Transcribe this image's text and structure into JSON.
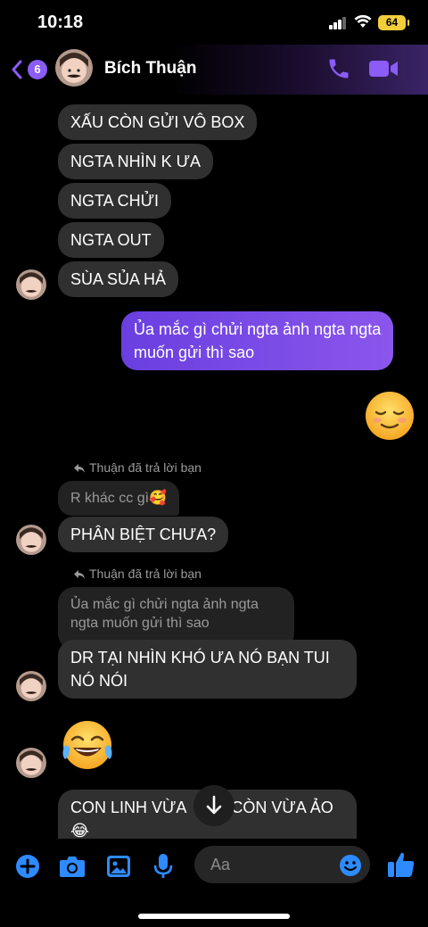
{
  "status": {
    "time": "10:18",
    "battery": "64"
  },
  "header": {
    "unread_count": "6",
    "name": "Bích Thuận"
  },
  "messages": {
    "m1": "XẤU CÒN GỬI VÔ BOX",
    "m2": "NGTA NHÌN K ƯA",
    "m3": "NGTA CHỬI",
    "m4": "NGTA OUT",
    "m5": "SÙA SỦA HẢ",
    "sent1_line1": "Ủa mắc gì chửi ngta ảnh ngta ngta",
    "sent1_line2": "muốn gửi thì sao",
    "reply_label_1": "Thuận đã trả lời bạn",
    "quote1": "R khác cc gì🥰",
    "m6": "PHÂN BIỆT CHƯA?",
    "reply_label_2": "Thuận đã trả lời bạn",
    "quote2_line1": "Ủa mắc gì chửi ngta ảnh ngta",
    "quote2_line2": "ngta muốn gửi thì sao",
    "m7_line1": "DR TẠI NHÌN KHÓ ƯA NÓ BẠN TUI",
    "m7_line2": "NÓ NÓI",
    "m8_line1": "CON LINH VỪA",
    "m8_line1b": "CÒN VỪA ẢO",
    "m8_line2": "😂"
  },
  "composer": {
    "placeholder": "Aa"
  },
  "icons": {
    "back": "chevron-left-icon",
    "call": "phone-icon",
    "video": "video-camera-icon",
    "add": "plus-circle-icon",
    "camera": "camera-icon",
    "gallery": "image-icon",
    "mic": "microphone-icon",
    "emoji": "smiley-icon",
    "like": "thumbs-up-icon",
    "scroll": "arrow-down-icon"
  },
  "colors": {
    "accent": "#8b5cf6",
    "bubble_received": "#303030",
    "bubble_sent": "#7b4de6",
    "icon_blue": "#2e8bff"
  }
}
